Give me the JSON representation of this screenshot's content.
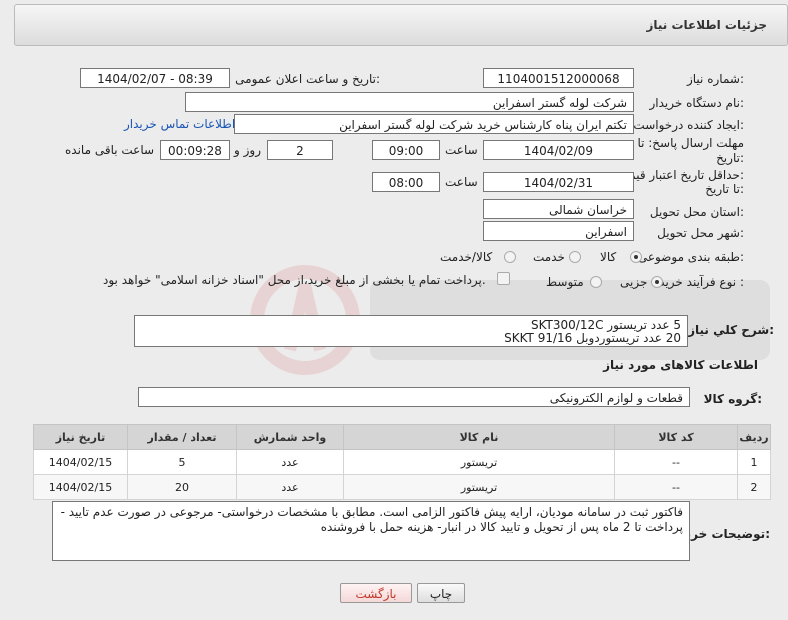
{
  "header": {
    "title": "جزئیات اطلاعات نیاز"
  },
  "fields": {
    "need_number_label": "شماره نیاز:",
    "need_number": "1104001512000068",
    "announce_label": "تاریخ و ساعت اعلان عمومی:",
    "announce_value": "1404/02/07 - 08:39",
    "buyer_org_label": "نام دستگاه خریدار:",
    "buyer_org": "شرکت لوله گستر اسفراین",
    "creator_label": "ایجاد کننده درخواست:",
    "creator": "تکتم ایران پناه کارشناس خرید شرکت لوله گستر اسفراین",
    "contact_link": "اطلاعات تماس خریدار",
    "reply_deadline_label_1": "مهلت ارسال پاسخ: تا",
    "reply_deadline_label_2": "تاریخ:",
    "reply_date": "1404/02/09",
    "time_label": "ساعت",
    "reply_time": "09:00",
    "days_value": "2",
    "days_label": "روز و",
    "remaining_time": "00:09:28",
    "remaining_label": "ساعت باقی مانده",
    "price_valid_label_1": "حداقل تاریخ اعتبار قیمت:",
    "price_valid_label_2": "تا تاریخ:",
    "price_date": "1404/02/31",
    "price_time": "08:00",
    "province_label": "استان محل تحویل:",
    "province": "خراسان شمالی",
    "city_label": "شهر محل تحویل:",
    "city": "اسفراین",
    "category_label": "طبقه بندی موضوعی:",
    "category_options": [
      "کالا",
      "خدمت",
      "کالا/خدمت"
    ],
    "category_selected": "کالا",
    "process_label": "نوع فرآیند خرید :",
    "process_options": [
      "جزیی",
      "متوسط"
    ],
    "process_selected": "جزیی",
    "payment_note": "پرداخت تمام یا بخشی از مبلغ خرید،از محل \"اسناد خزانه اسلامی\" خواهد بود."
  },
  "description": {
    "label": "شرح کلي نياز:",
    "lines": [
      "5 عدد تریستور SKT300/12C",
      "20 عدد تریستوردوبل SKKT 91/16"
    ]
  },
  "goods": {
    "section_title": "اطلاعات کالاهای مورد نیاز",
    "group_label": "گروه کالا:",
    "group_value": "قطعات و لوازم الکترونیکی",
    "columns": [
      "ردیف",
      "کد کالا",
      "نام کالا",
      "واحد شمارش",
      "تعداد / مقدار",
      "تاریخ نیاز"
    ],
    "rows": [
      [
        "1",
        "--",
        "تریستور",
        "عدد",
        "5",
        "1404/02/15"
      ],
      [
        "2",
        "--",
        "تریستور",
        "عدد",
        "20",
        "1404/02/15"
      ]
    ]
  },
  "buyer_notes": {
    "label": "توضیحات خریدار:",
    "text": "فاکتور ثبت در سامانه مودیان، ارایه پیش فاکتور الزامی است. مطابق با مشخصات درخواستی- مرجوعی در صورت عدم تایید - پرداخت تا 2 ماه پس از تحویل و تایید کالا در انبار- هزینه حمل با فروشنده"
  },
  "buttons": {
    "print": "چاپ",
    "back": "بازگشت"
  }
}
